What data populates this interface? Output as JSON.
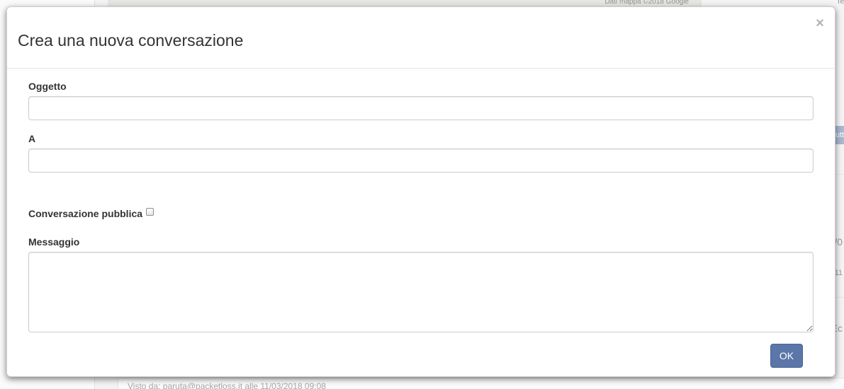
{
  "background": {
    "map_credit": "Dati mappa ©2018 Google",
    "map_terms": "Te",
    "right_button_fragment": "utt",
    "right_fragments": [
      "/0",
      "11",
      "Ec"
    ],
    "footer_text": "Visto da: paruta@packetloss.it alle 11/03/2018 09:08"
  },
  "modal": {
    "title": "Crea una nuova conversazione",
    "close_label": "×",
    "subject": {
      "label": "Oggetto",
      "value": "",
      "placeholder": ""
    },
    "recipients": {
      "label": "A",
      "value": "",
      "placeholder": ""
    },
    "public_conversation": {
      "label": "Conversazione pubblica",
      "checked": false
    },
    "message": {
      "label": "Messaggio",
      "value": "",
      "placeholder": ""
    },
    "ok_label": "OK"
  },
  "colors": {
    "primary_button": "#5b76a8",
    "title_text": "#333333",
    "input_border": "#cccccc"
  }
}
